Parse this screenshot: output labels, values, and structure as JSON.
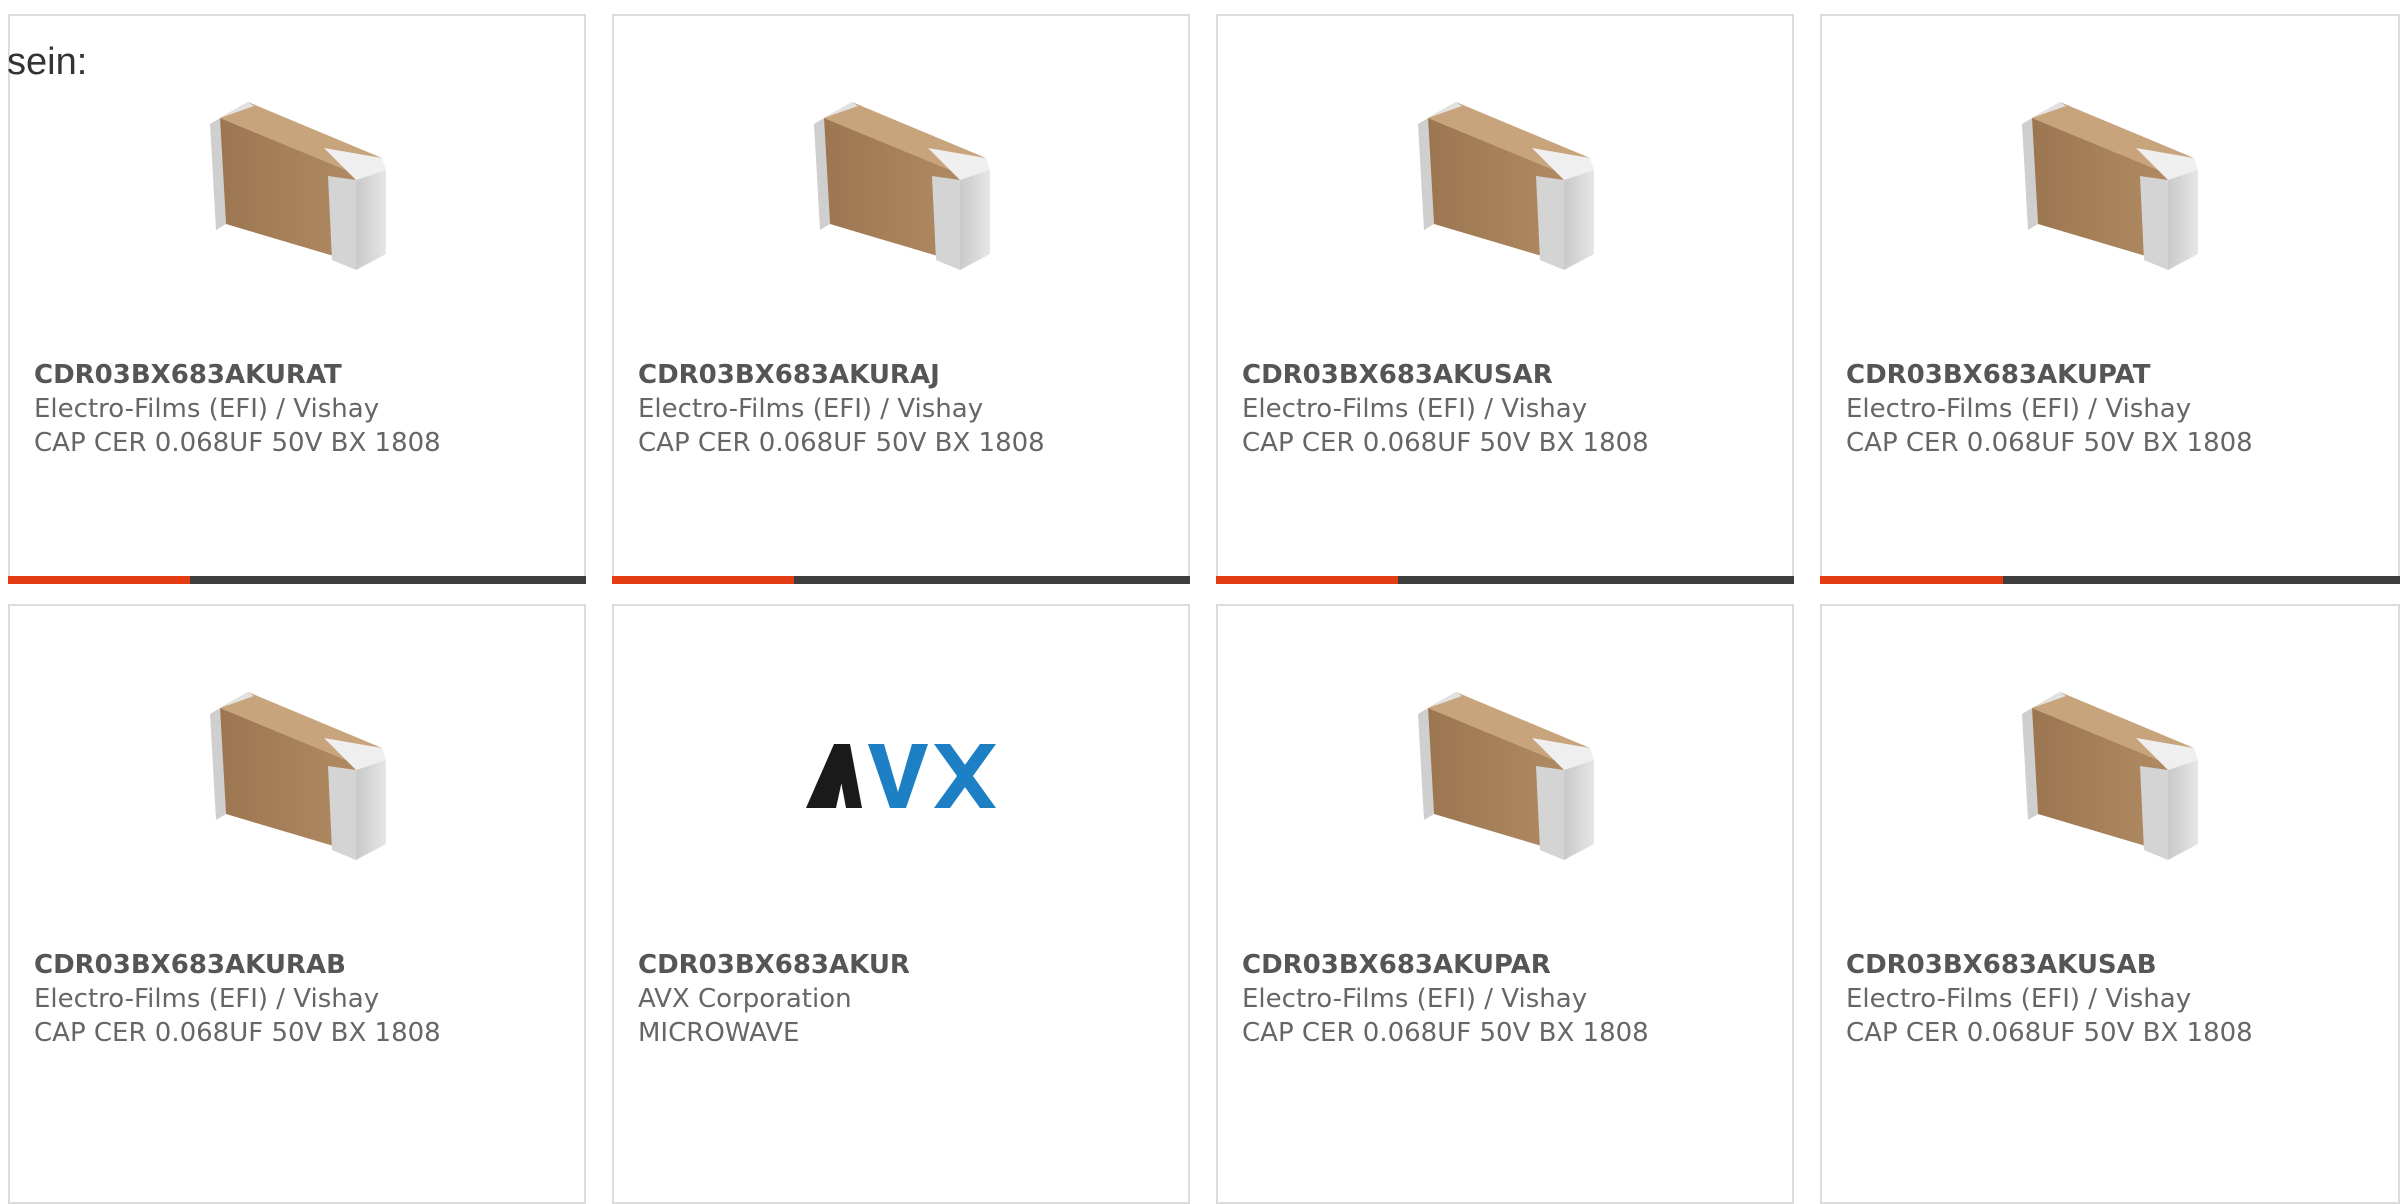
{
  "lead_text": "sein:",
  "accent_color": "#e33b12",
  "bar_color": "#3e3e3e",
  "cards": [
    {
      "part_number": "CDR03BX683AKURAT",
      "manufacturer": "Electro-Films (EFI) / Vishay",
      "description": "CAP CER 0.068UF 50V BX 1808",
      "image": "ceramic-capacitor-icon",
      "progress": 0.315
    },
    {
      "part_number": "CDR03BX683AKURAJ",
      "manufacturer": "Electro-Films (EFI) / Vishay",
      "description": "CAP CER 0.068UF 50V BX 1808",
      "image": "ceramic-capacitor-icon",
      "progress": 0.315
    },
    {
      "part_number": "CDR03BX683AKUSAR",
      "manufacturer": "Electro-Films (EFI) / Vishay",
      "description": "CAP CER 0.068UF 50V BX 1808",
      "image": "ceramic-capacitor-icon",
      "progress": 0.315
    },
    {
      "part_number": "CDR03BX683AKUPAT",
      "manufacturer": "Electro-Films (EFI) / Vishay",
      "description": "CAP CER 0.068UF 50V BX 1808",
      "image": "ceramic-capacitor-icon",
      "progress": 0.315
    },
    {
      "part_number": "CDR03BX683AKURAB",
      "manufacturer": "Electro-Films (EFI) / Vishay",
      "description": "CAP CER 0.068UF 50V BX 1808",
      "image": "ceramic-capacitor-icon"
    },
    {
      "part_number": "CDR03BX683AKUR",
      "manufacturer": "AVX Corporation",
      "description": "MICROWAVE",
      "image": "avx-logo",
      "logo_text": "AVX",
      "logo_colors": [
        "#1a1a1a",
        "#1d7fc4"
      ]
    },
    {
      "part_number": "CDR03BX683AKUPAR",
      "manufacturer": "Electro-Films (EFI) / Vishay",
      "description": "CAP CER 0.068UF 50V BX 1808",
      "image": "ceramic-capacitor-icon"
    },
    {
      "part_number": "CDR03BX683AKUSAB",
      "manufacturer": "Electro-Films (EFI) / Vishay",
      "description": "CAP CER 0.068UF 50V BX 1808",
      "image": "ceramic-capacitor-icon"
    }
  ]
}
